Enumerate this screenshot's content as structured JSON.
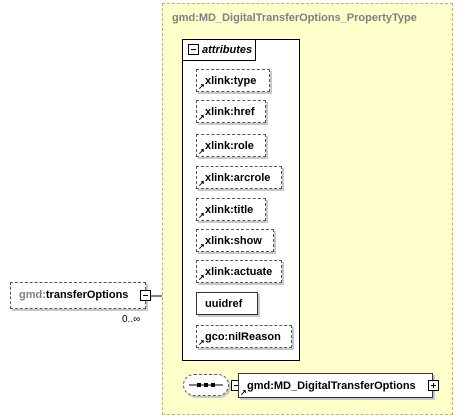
{
  "type": {
    "title": "gmd:MD_DigitalTransferOptions_PropertyType"
  },
  "element": {
    "prefix": "gmd:",
    "name": "transferOptions",
    "cardinality": "0..∞"
  },
  "attributes": {
    "label": "attributes",
    "items": [
      {
        "name": "xlink:type"
      },
      {
        "name": "xlink:href"
      },
      {
        "name": "xlink:role"
      },
      {
        "name": "xlink:arcrole"
      },
      {
        "name": "xlink:title"
      },
      {
        "name": "xlink:show"
      },
      {
        "name": "xlink:actuate"
      },
      {
        "name": "uuidref"
      },
      {
        "name": "gco:nilReason"
      }
    ]
  },
  "child": {
    "name": "gmd:MD_DigitalTransferOptions"
  },
  "icons": {
    "collapse": "minus-box-icon",
    "expand": "plus-box-icon",
    "reference": "reference-arrow-icon",
    "sequence": "sequence-compositor-icon"
  }
}
